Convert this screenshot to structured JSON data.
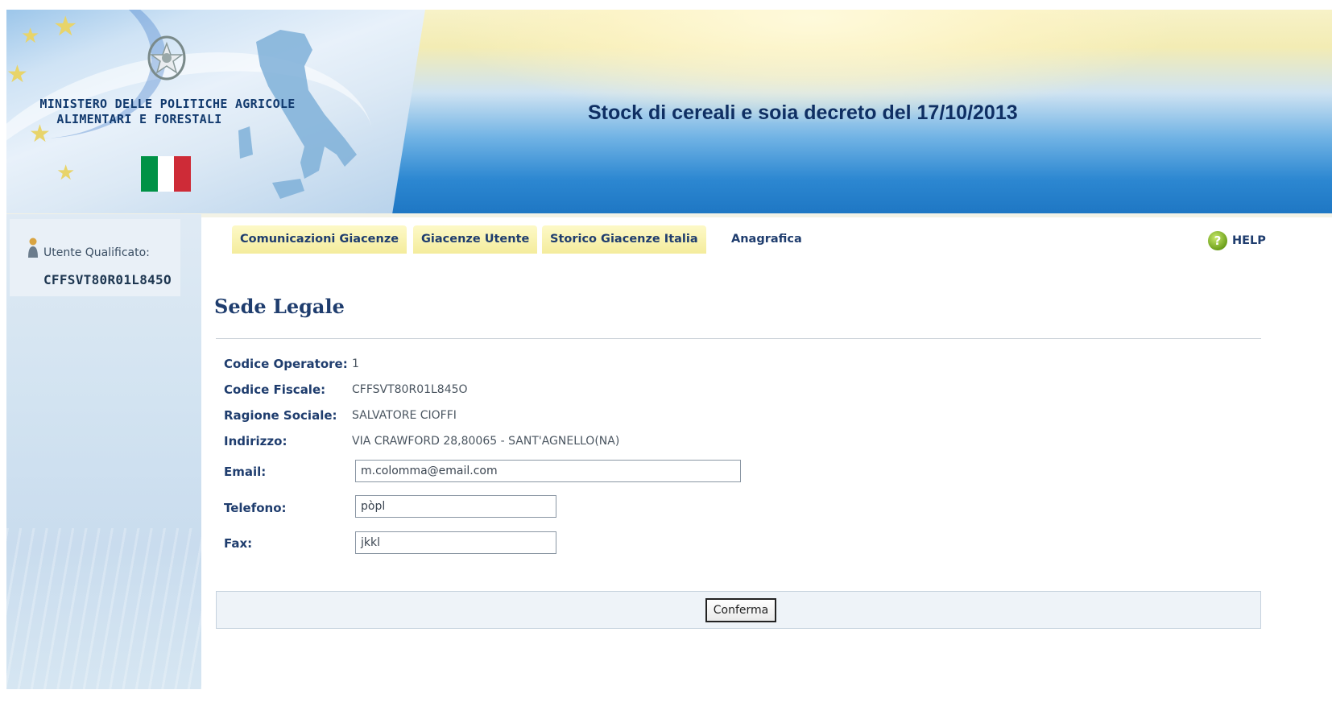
{
  "header": {
    "ministry_line1": "MINISTERO DELLE POLITICHE AGRICOLE",
    "ministry_line2": "ALIMENTARI E FORESTALI",
    "app_title": "Stock di cereali e soia decreto del 17/10/2013"
  },
  "sidebar": {
    "user_label": "Utente Qualificato:",
    "user_code": "CFFSVT80R01L845O"
  },
  "tabs": [
    {
      "label": "Comunicazioni Giacenze",
      "active": true
    },
    {
      "label": "Giacenze Utente",
      "active": true
    },
    {
      "label": "Storico Giacenze Italia",
      "active": true
    },
    {
      "label": "Anagrafica",
      "active": false
    }
  ],
  "help_label": "HELP",
  "main": {
    "section_title": "Sede Legale",
    "fields": {
      "codice_operatore": {
        "label": "Codice Operatore:",
        "value": "1"
      },
      "codice_fiscale": {
        "label": "Codice Fiscale:",
        "value": "CFFSVT80R01L845O"
      },
      "ragione_sociale": {
        "label": "Ragione Sociale:",
        "value": "SALVATORE CIOFFI"
      },
      "indirizzo": {
        "label": "Indirizzo:",
        "value": "VIA CRAWFORD 28,80065 - SANT'AGNELLO(NA)"
      },
      "email": {
        "label": "Email:",
        "value": "m.colomma@email.com"
      },
      "telefono": {
        "label": "Telefono:",
        "value": "pòpl"
      },
      "fax": {
        "label": "Fax:",
        "value": "jkkl"
      }
    },
    "confirm_label": "Conferma"
  },
  "colors": {
    "flag_green": "#009246",
    "flag_white": "#ffffff",
    "flag_red": "#ce2b37",
    "title_blue": "#0f2f63",
    "label_blue": "#1f3d6e"
  }
}
